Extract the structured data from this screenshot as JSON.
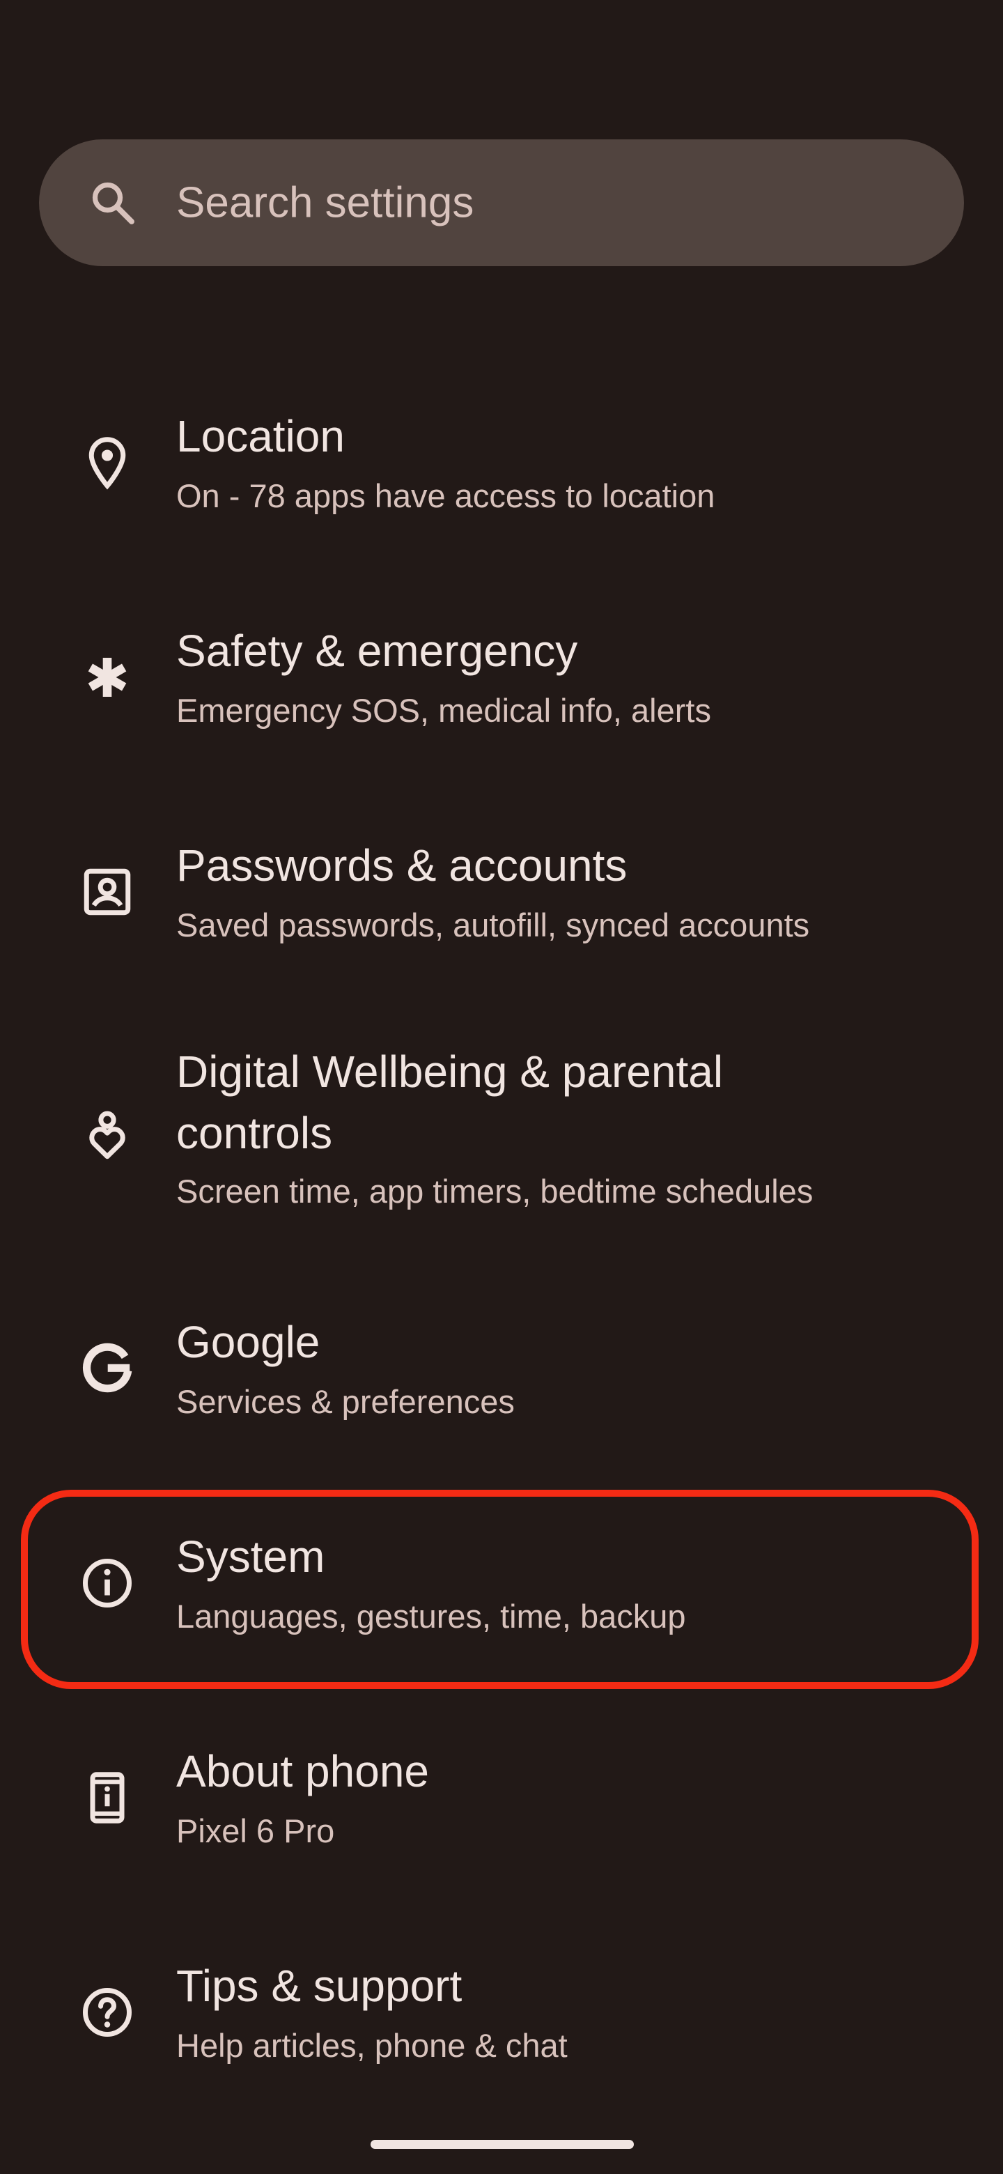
{
  "search": {
    "placeholder": "Search settings",
    "icon": "search-icon"
  },
  "items": [
    {
      "title": "Location",
      "subtitle": "On - 78 apps have access to location",
      "icon": "location-pin-icon"
    },
    {
      "title": "Safety & emergency",
      "subtitle": "Emergency SOS, medical info, alerts",
      "icon": "asterisk-icon"
    },
    {
      "title": "Passwords & accounts",
      "subtitle": "Saved passwords, autofill, synced accounts",
      "icon": "account-box-icon"
    },
    {
      "title": "Digital Wellbeing & parental controls",
      "subtitle": "Screen time, app timers, bedtime schedules",
      "icon": "wellbeing-icon"
    },
    {
      "title": "Google",
      "subtitle": "Services & preferences",
      "icon": "google-g-icon"
    },
    {
      "title": "System",
      "subtitle": "Languages, gestures, time, backup",
      "icon": "info-icon"
    },
    {
      "title": "About phone",
      "subtitle": "Pixel 6 Pro",
      "icon": "phone-info-icon"
    },
    {
      "title": "Tips & support",
      "subtitle": "Help articles, phone & chat",
      "icon": "help-icon"
    }
  ],
  "colors": {
    "background": "#221917",
    "search_background": "#51443f",
    "primary_text": "#f1e5e1",
    "secondary_text": "#d8c2bc",
    "highlight": "#f42b14"
  }
}
